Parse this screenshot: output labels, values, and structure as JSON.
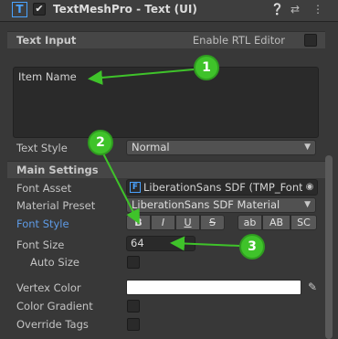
{
  "header": {
    "title": "TextMeshPro - Text (UI)",
    "icon": "T",
    "enabled_mark": "✔",
    "icons": [
      "help-icon",
      "presets-icon",
      "more-icon"
    ]
  },
  "text_input": {
    "section_label": "Text Input",
    "rtl_label": "Enable RTL Editor",
    "value": "Item Name",
    "text_style_label": "Text Style",
    "text_style_value": "Normal"
  },
  "main_settings": {
    "section_label": "Main Settings",
    "font_asset_label": "Font Asset",
    "font_asset_icon": "F",
    "font_asset_value": "LiberationSans SDF (TMP_Font",
    "material_preset_label": "Material Preset",
    "material_preset_value": "LiberationSans SDF Material",
    "font_style_label": "Font Style",
    "font_style_buttons": [
      "B",
      "I",
      "U",
      "S",
      "ab",
      "AB",
      "SC"
    ],
    "font_size_label": "Font Size",
    "font_size_value": "64",
    "auto_size_label": "Auto Size",
    "vertex_color_label": "Vertex Color",
    "vertex_color": "#ffffff",
    "color_gradient_label": "Color Gradient",
    "override_tags_label": "Override Tags"
  },
  "callouts": [
    "1",
    "2",
    "3"
  ],
  "colors": {
    "accent": "#3fc32a",
    "link_blue": "#5e9be6",
    "tmp_blue": "#4aa3ff"
  }
}
